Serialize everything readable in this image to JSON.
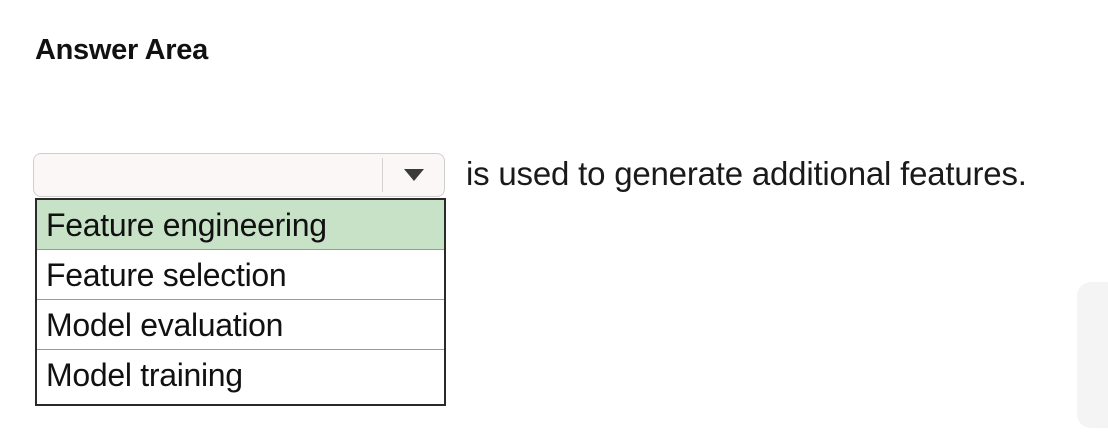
{
  "answer_area": {
    "heading": "Answer Area"
  },
  "question": {
    "dropdown": {
      "selected_value": "",
      "arrow_icon": "triangle-down-icon",
      "options": [
        {
          "label": "Feature engineering",
          "highlighted": true
        },
        {
          "label": "Feature selection",
          "highlighted": false
        },
        {
          "label": "Model evaluation",
          "highlighted": false
        },
        {
          "label": "Model training",
          "highlighted": false
        }
      ]
    },
    "sentence_suffix": "is used to generate additional features."
  },
  "colors": {
    "highlight": "#c7e2c7",
    "select_background": "#fbf7f7",
    "list_border": "#2a2a2a"
  }
}
